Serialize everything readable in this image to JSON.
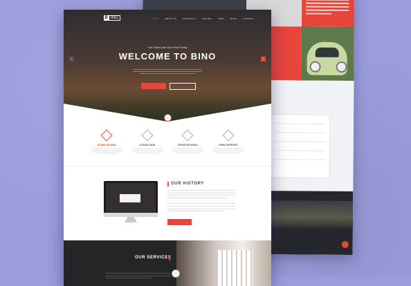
{
  "colors": {
    "background": "#9b9cdc",
    "accent": "#e8453c",
    "dark": "#242527"
  },
  "header": {
    "logo_letter": "B",
    "logo_text": "INO",
    "nav": [
      "HOME",
      "ABOUT US",
      "PORTFOLIO",
      "PRICING",
      "TEAM",
      "BLOG",
      "CONTACT"
    ]
  },
  "hero": {
    "tagline": "Our Clients Are Our First Priority",
    "title": "WELCOME TO BINO",
    "primary_button": "",
    "secondary_button": "",
    "prev_icon": "chevron-left-icon",
    "next_icon": "chevron-right-icon"
  },
  "features": [
    {
      "title": "SLEEK DESIGN",
      "icon": "diamond-icon",
      "highlight": true
    },
    {
      "title": "CLEAN CODE",
      "icon": "code-icon",
      "highlight": false
    },
    {
      "title": "CREATIVE IDEAS",
      "icon": "bulb-icon",
      "highlight": false
    },
    {
      "title": "FREE SUPPORT",
      "icon": "support-icon",
      "highlight": false
    }
  ],
  "history": {
    "title": "OUR HISTORY",
    "button": ""
  },
  "services": {
    "title": "OUR SERVICES",
    "subtitle": ""
  }
}
